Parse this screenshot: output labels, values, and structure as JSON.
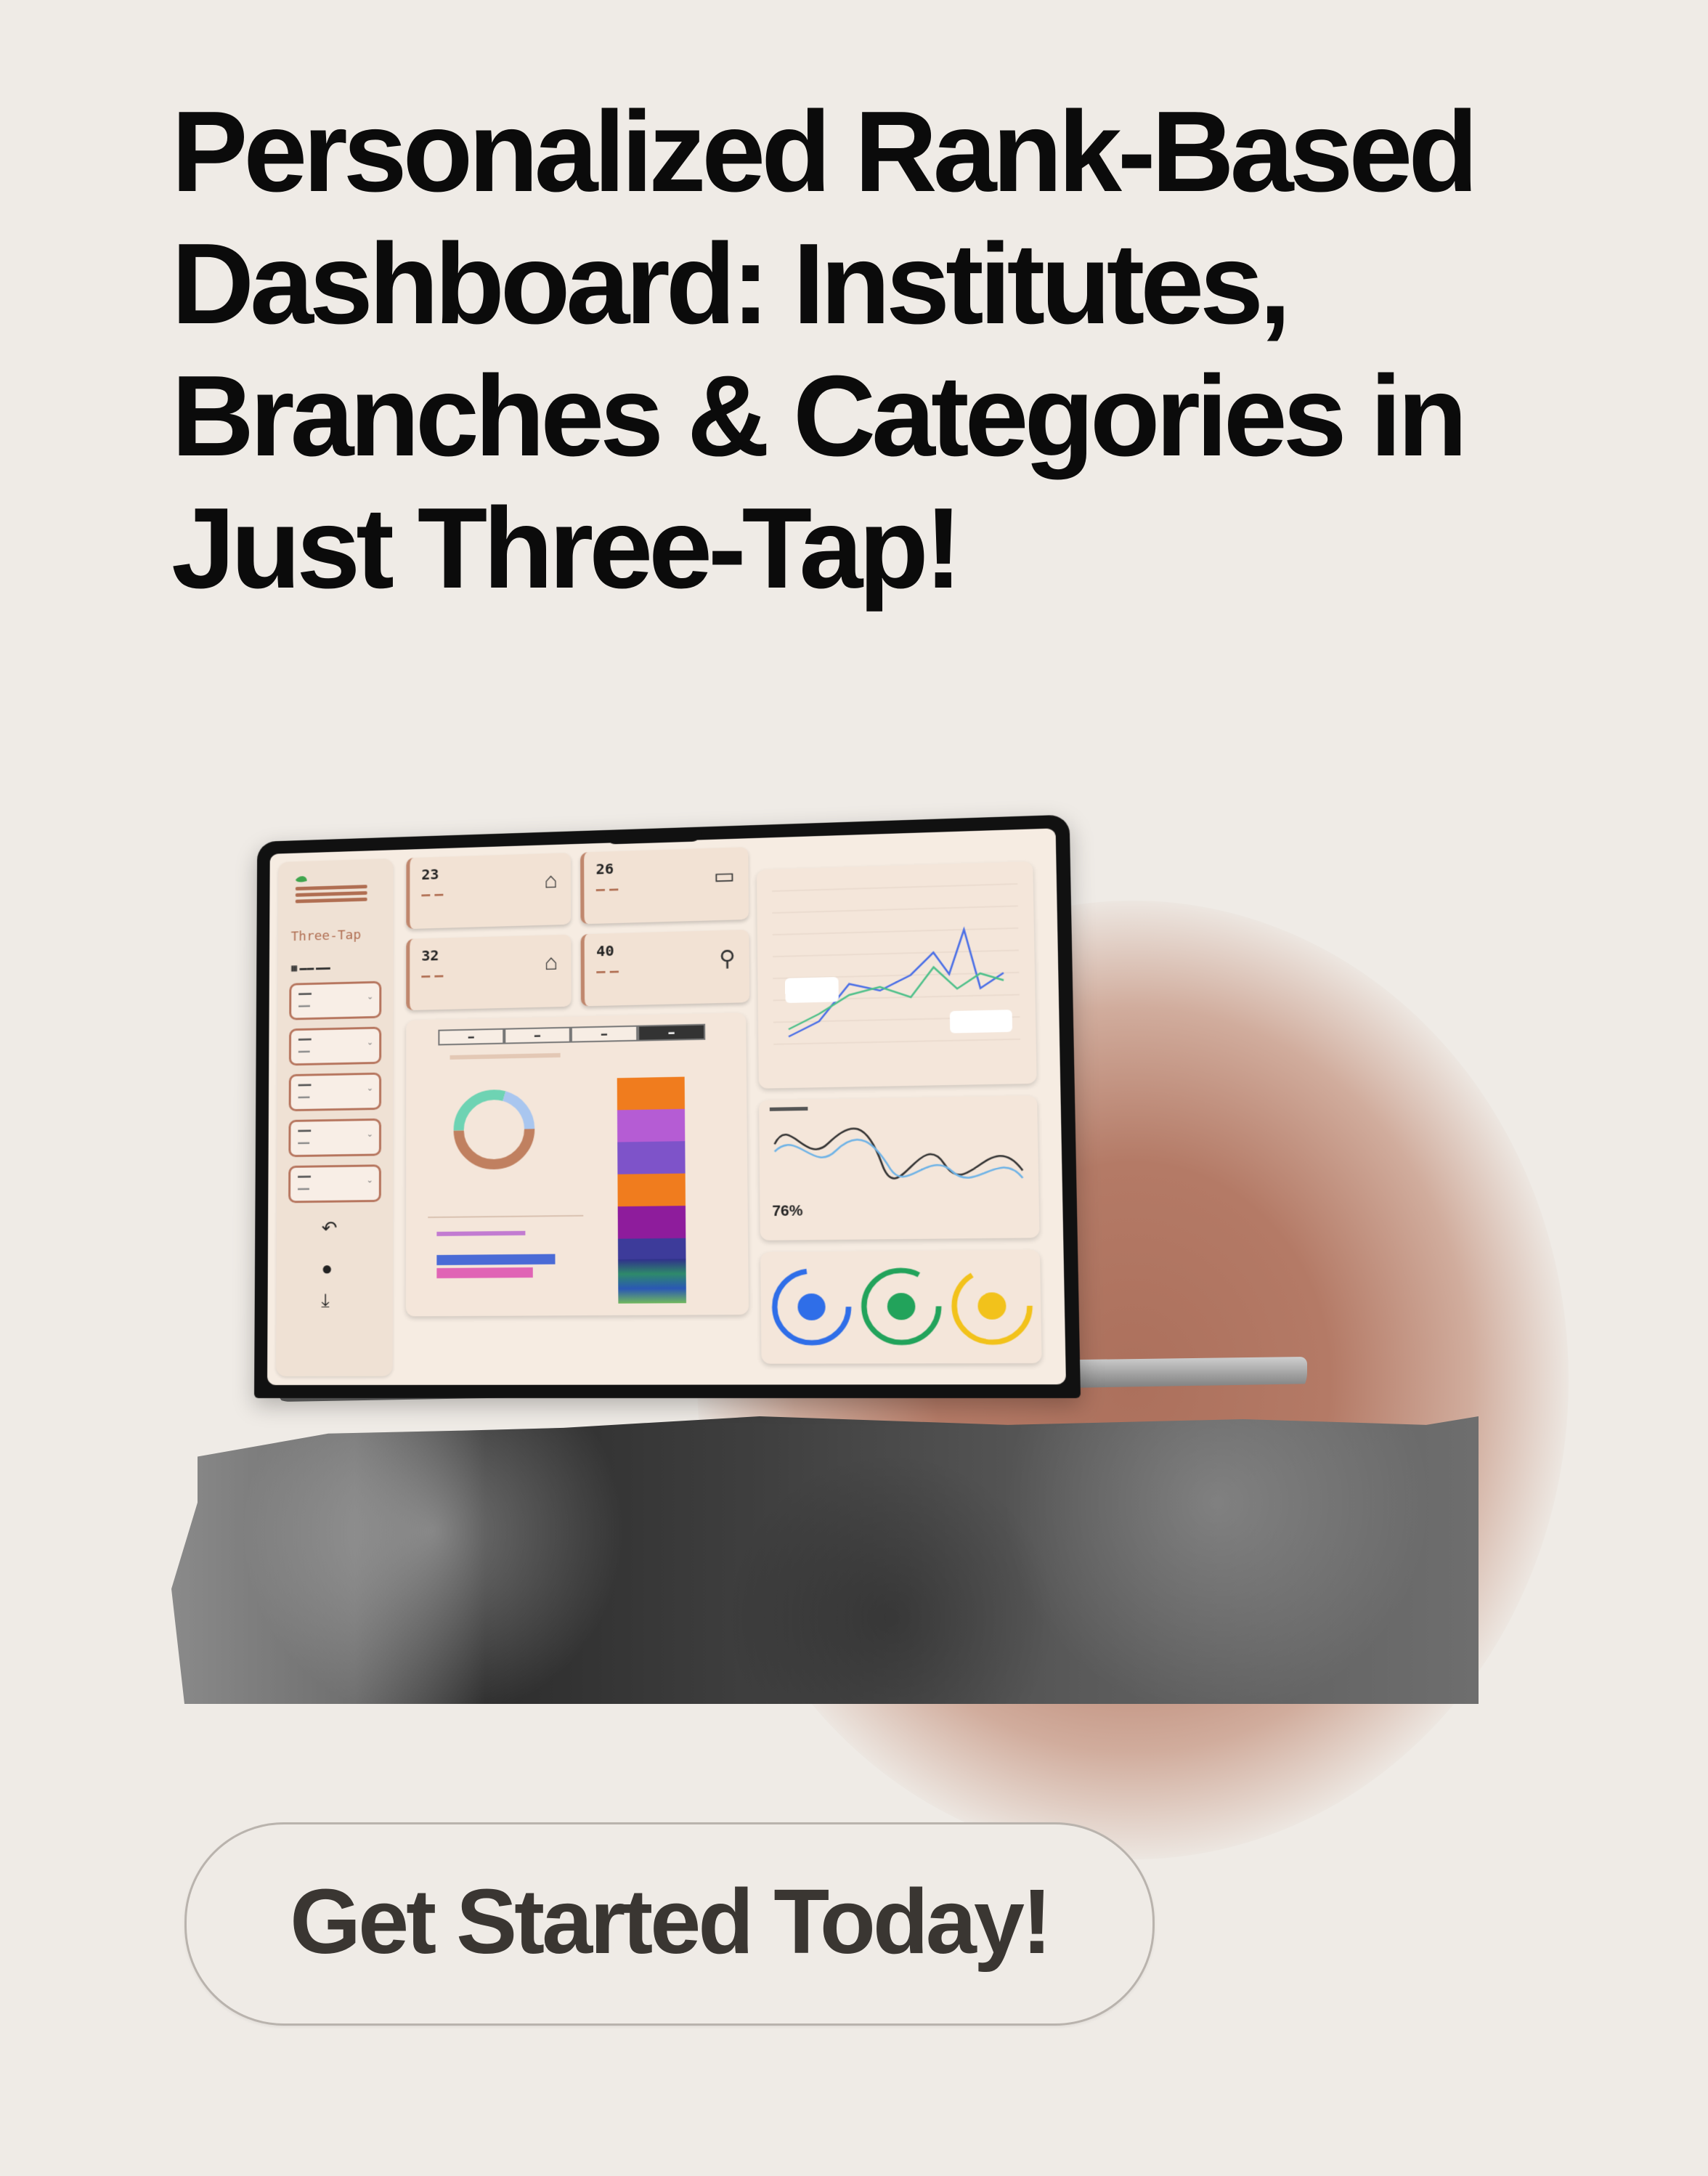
{
  "headline": {
    "line1": "Personalized Rank-Based",
    "line2": "Dashboard: Institutes,",
    "line3": "Branches & Categories in",
    "line4": "Just Three-Tap!"
  },
  "cta_label": "Get Started Today!",
  "dashboard": {
    "logo_text": "Three-Tap",
    "cards": [
      {
        "value": "23"
      },
      {
        "value": "26"
      },
      {
        "value": "32"
      },
      {
        "value": "40"
      }
    ],
    "metric_percent": "76%"
  },
  "colors": {
    "background": "#efebe6",
    "glow": "#b17663",
    "accent": "#b06e52"
  }
}
